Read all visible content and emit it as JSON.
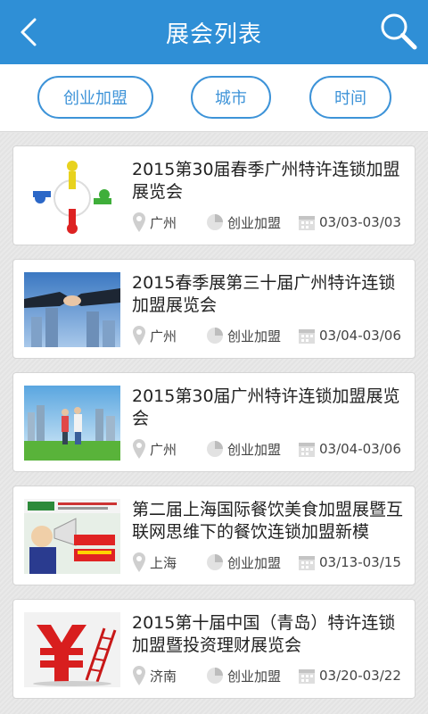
{
  "header": {
    "title": "展会列表",
    "back_icon": "chevron-left-icon",
    "search_icon": "search-icon"
  },
  "filters": [
    {
      "label": "创业加盟"
    },
    {
      "label": "城市"
    },
    {
      "label": "时间"
    }
  ],
  "colors": {
    "accent": "#2f8fd6",
    "filter_border": "#3d93d8"
  },
  "items": [
    {
      "title": "2015第30届春季广州特许连锁加盟展览会",
      "city": "广州",
      "category": "创业加盟",
      "date": "03/03-03/03",
      "thumb_icon": "people-circle-image"
    },
    {
      "title": "2015春季展第三十届广州特许连锁加盟展览会",
      "city": "广州",
      "category": "创业加盟",
      "date": "03/04-03/06",
      "thumb_icon": "handshake-city-image"
    },
    {
      "title": "2015第30届广州特许连锁加盟展览会",
      "city": "广州",
      "category": "创业加盟",
      "date": "03/04-03/06",
      "thumb_icon": "couple-field-image"
    },
    {
      "title": "第二届上海国际餐饮美食加盟展暨互联网思维下的餐饮连锁加盟新模",
      "city": "上海",
      "category": "创业加盟",
      "date": "03/13-03/15",
      "thumb_icon": "poster-megaphone-image"
    },
    {
      "title": "2015第十届中国（青岛）特许连锁加盟暨投资理财展览会",
      "city": "济南",
      "category": "创业加盟",
      "date": "03/20-03/22",
      "thumb_icon": "yuan-ladder-image"
    }
  ]
}
